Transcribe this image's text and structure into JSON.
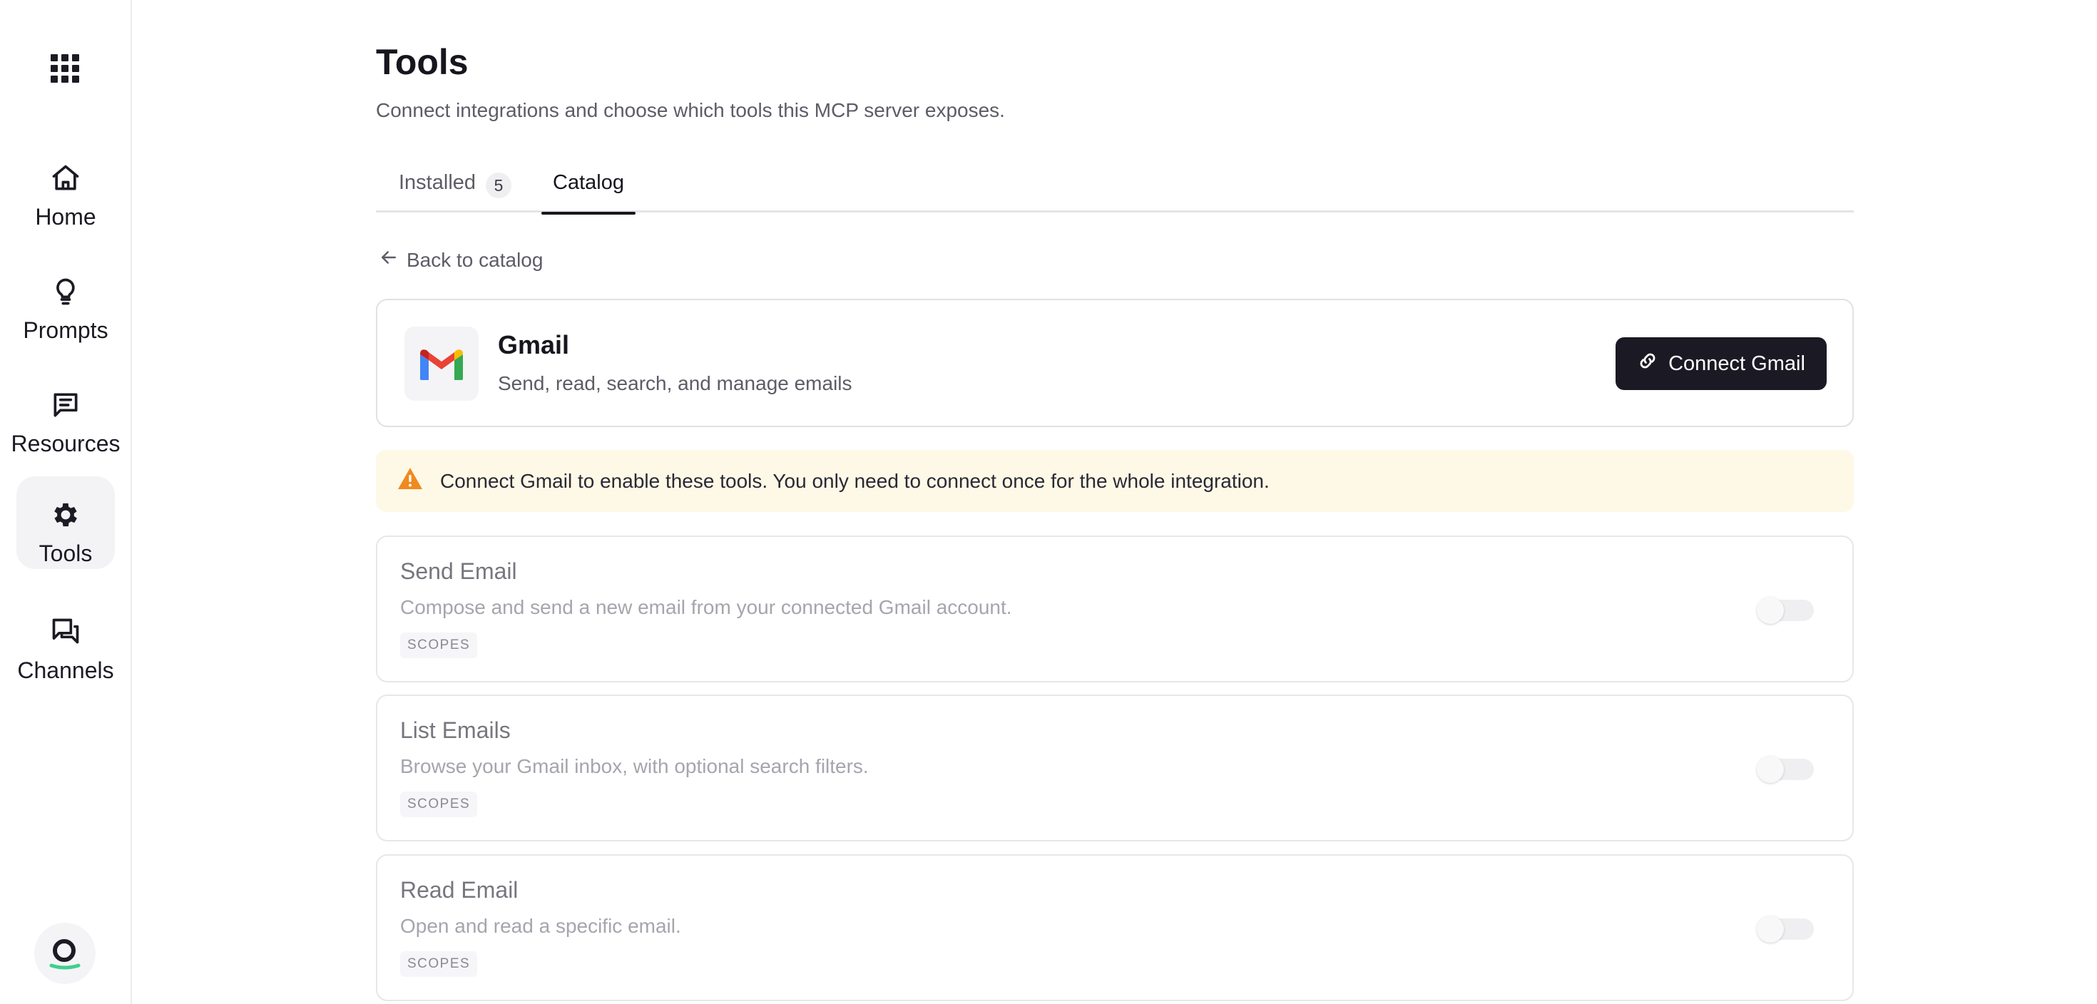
{
  "sidebar": {
    "items": [
      {
        "label": "Home",
        "icon": "home-icon"
      },
      {
        "label": "Prompts",
        "icon": "lightbulb-icon"
      },
      {
        "label": "Resources",
        "icon": "message-square-icon"
      },
      {
        "label": "Tools",
        "icon": "gear-icon",
        "active": true
      },
      {
        "label": "Channels",
        "icon": "messages-icon"
      }
    ]
  },
  "page": {
    "title": "Tools",
    "subtitle": "Connect integrations and choose which tools this MCP server exposes."
  },
  "tabs": {
    "installed_label": "Installed",
    "installed_count": "5",
    "catalog_label": "Catalog",
    "active": "Catalog"
  },
  "back_link": "Back to catalog",
  "integration": {
    "name": "Gmail",
    "description": "Send, read, search, and manage emails",
    "connect_label": "Connect Gmail"
  },
  "alert": {
    "text": "Connect Gmail to enable these tools. You only need to connect once for the whole integration."
  },
  "tools": [
    {
      "name": "Send Email",
      "description": "Compose and send a new email from your connected Gmail account.",
      "scopes_label": "SCOPES",
      "enabled": false
    },
    {
      "name": "List Emails",
      "description": "Browse your Gmail inbox, with optional search filters.",
      "scopes_label": "SCOPES",
      "enabled": false
    },
    {
      "name": "Read Email",
      "description": "Open and read a specific email.",
      "scopes_label": "SCOPES",
      "enabled": false
    }
  ],
  "colors": {
    "primary_button": "#1b1a24",
    "alert_background": "#fef8e7",
    "warning_icon": "#f08a1d"
  }
}
